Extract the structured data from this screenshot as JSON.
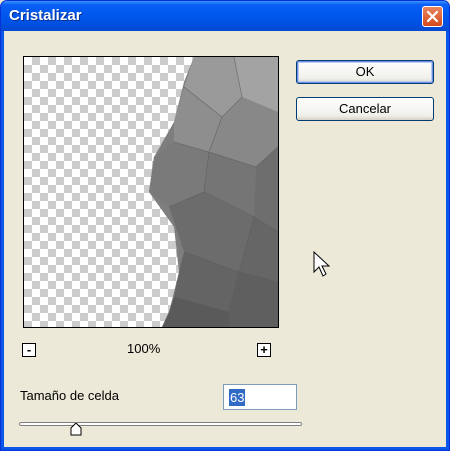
{
  "window": {
    "title": "Cristalizar"
  },
  "buttons": {
    "ok": "OK",
    "cancel": "Cancelar"
  },
  "zoom": {
    "minus": "-",
    "plus": "+",
    "level": "100%"
  },
  "cell_size": {
    "label": "Tamaño de celda",
    "value": "63",
    "slider_fraction": 0.2
  },
  "icons": {
    "close": "close-icon",
    "cursor": "arrow-cursor-icon"
  },
  "colors": {
    "titlebar": "#0058EE",
    "close_button": "#D64A1A",
    "dialog_bg": "#ECE9D8",
    "selection": "#316AC5"
  }
}
